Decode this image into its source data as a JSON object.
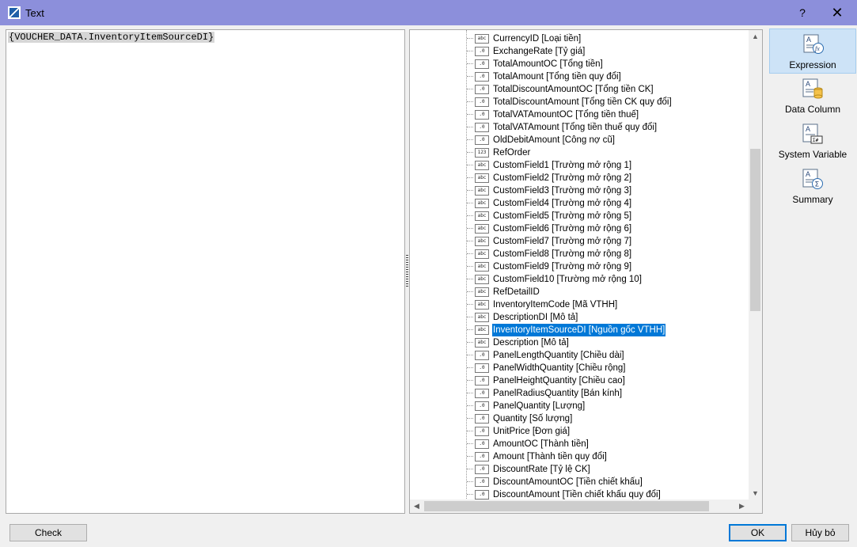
{
  "window": {
    "title": "Text",
    "help": "?",
    "close": "✕"
  },
  "editor": {
    "expression": "{VOUCHER_DATA.InventoryItemSourceDI}"
  },
  "tree": {
    "items": [
      {
        "icon": "abc",
        "label": "CurrencyID [Loại tiền]"
      },
      {
        "icon": ".0",
        "label": "ExchangeRate [Tỷ giá]"
      },
      {
        "icon": ".0",
        "label": "TotalAmountOC [Tổng tiền]"
      },
      {
        "icon": ".0",
        "label": "TotalAmount [Tổng tiền quy đổi]"
      },
      {
        "icon": ".0",
        "label": "TotalDiscountAmountOC [Tổng tiền CK]"
      },
      {
        "icon": ".0",
        "label": "TotalDiscountAmount [Tổng tiền CK quy đổi]"
      },
      {
        "icon": ".0",
        "label": "TotalVATAmountOC [Tổng tiền thuế]"
      },
      {
        "icon": ".0",
        "label": "TotalVATAmount [Tổng tiền thuế quy đổi]"
      },
      {
        "icon": ".0",
        "label": "OldDebitAmount [Công nợ cũ]"
      },
      {
        "icon": "123",
        "label": "RefOrder"
      },
      {
        "icon": "abc",
        "label": "CustomField1 [Trường mở rộng 1]"
      },
      {
        "icon": "abc",
        "label": "CustomField2 [Trường mở rộng 2]"
      },
      {
        "icon": "abc",
        "label": "CustomField3 [Trường mở rộng 3]"
      },
      {
        "icon": "abc",
        "label": "CustomField4 [Trường mở rộng 4]"
      },
      {
        "icon": "abc",
        "label": "CustomField5 [Trường mở rộng 5]"
      },
      {
        "icon": "abc",
        "label": "CustomField6 [Trường mở rộng 6]"
      },
      {
        "icon": "abc",
        "label": "CustomField7 [Trường mở rộng 7]"
      },
      {
        "icon": "abc",
        "label": "CustomField8 [Trường mở rộng 8]"
      },
      {
        "icon": "abc",
        "label": "CustomField9 [Trường mở rộng 9]"
      },
      {
        "icon": "abc",
        "label": "CustomField10 [Trường mở rộng 10]"
      },
      {
        "icon": "abc",
        "label": "RefDetailID"
      },
      {
        "icon": "abc",
        "label": "InventoryItemCode [Mã VTHH]"
      },
      {
        "icon": "abc",
        "label": "DescriptionDI [Mô tả]"
      },
      {
        "icon": "abc",
        "label": "InventoryItemSourceDI [Nguồn gốc VTHH]",
        "selected": true
      },
      {
        "icon": "abc",
        "label": "Description [Mô tả]"
      },
      {
        "icon": ".0",
        "label": "PanelLengthQuantity [Chiều dài]"
      },
      {
        "icon": ".0",
        "label": "PanelWidthQuantity [Chiều rộng]"
      },
      {
        "icon": ".0",
        "label": "PanelHeightQuantity [Chiều cao]"
      },
      {
        "icon": ".0",
        "label": "PanelRadiusQuantity [Bán kính]"
      },
      {
        "icon": ".0",
        "label": "PanelQuantity [Lượng]"
      },
      {
        "icon": ".0",
        "label": "Quantity [Số lượng]"
      },
      {
        "icon": ".0",
        "label": "UnitPrice [Đơn giá]"
      },
      {
        "icon": ".0",
        "label": "AmountOC [Thành tiền]"
      },
      {
        "icon": ".0",
        "label": "Amount [Thành tiền quy đổi]"
      },
      {
        "icon": ".0",
        "label": "DiscountRate [Tỷ lệ CK]"
      },
      {
        "icon": ".0",
        "label": "DiscountAmountOC [Tiền chiết khấu]"
      },
      {
        "icon": ".0",
        "label": "DiscountAmount [Tiền chiết khấu quy đổi]"
      }
    ]
  },
  "sidebar": {
    "items": [
      {
        "label": "Expression",
        "icon": "expression-icon",
        "active": true
      },
      {
        "label": "Data Column",
        "icon": "data-column-icon"
      },
      {
        "label": "System Variable",
        "icon": "system-variable-icon"
      },
      {
        "label": "Summary",
        "icon": "summary-icon"
      }
    ]
  },
  "buttons": {
    "check": "Check",
    "ok": "OK",
    "cancel": "Hủy bỏ"
  },
  "colors": {
    "titlebar": "#8c8fdb",
    "selection": "#0078d7",
    "active_side": "#cde3f7"
  }
}
